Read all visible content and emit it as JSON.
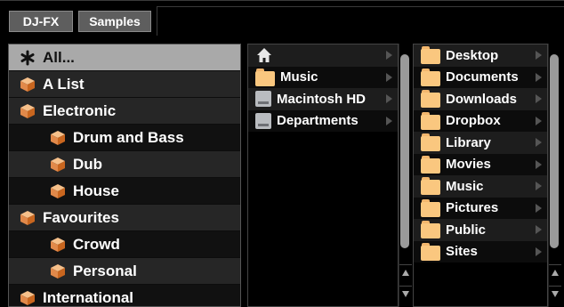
{
  "tabs": [
    {
      "label": "DJ-FX"
    },
    {
      "label": "Samples"
    }
  ],
  "tree": {
    "items": [
      {
        "label": "All...",
        "icon": "asterisk-icon",
        "indent": 0,
        "selected": true
      },
      {
        "label": "A List",
        "icon": "crate-icon",
        "indent": 0
      },
      {
        "label": "Electronic",
        "icon": "crate-icon",
        "indent": 0
      },
      {
        "label": "Drum and Bass",
        "icon": "crate-icon",
        "indent": 1
      },
      {
        "label": "Dub",
        "icon": "crate-icon",
        "indent": 1
      },
      {
        "label": "House",
        "icon": "crate-icon",
        "indent": 1
      },
      {
        "label": "Favourites",
        "icon": "crate-icon",
        "indent": 0
      },
      {
        "label": "Crowd",
        "icon": "crate-icon",
        "indent": 1
      },
      {
        "label": "Personal",
        "icon": "crate-icon",
        "indent": 1
      },
      {
        "label": "International",
        "icon": "crate-icon",
        "indent": 0
      }
    ]
  },
  "locations": {
    "items": [
      {
        "label": "",
        "icon": "home-icon"
      },
      {
        "label": "Music",
        "icon": "folder-icon"
      },
      {
        "label": "Macintosh HD",
        "icon": "drive-icon"
      },
      {
        "label": "Departments",
        "icon": "drive-icon"
      }
    ]
  },
  "folders": {
    "items": [
      {
        "label": "Desktop",
        "icon": "folder-icon"
      },
      {
        "label": "Documents",
        "icon": "folder-icon"
      },
      {
        "label": "Downloads",
        "icon": "folder-icon"
      },
      {
        "label": "Dropbox",
        "icon": "folder-icon"
      },
      {
        "label": "Library",
        "icon": "folder-icon"
      },
      {
        "label": "Movies",
        "icon": "folder-icon"
      },
      {
        "label": "Music",
        "icon": "folder-icon"
      },
      {
        "label": "Pictures",
        "icon": "folder-icon"
      },
      {
        "label": "Public",
        "icon": "folder-icon"
      },
      {
        "label": "Sites",
        "icon": "folder-icon"
      }
    ]
  },
  "colors": {
    "crate_top": "#f6c08a",
    "crate_side": "#d9762a",
    "folder": "#fac77f",
    "selected_row": "#a9a9a9"
  }
}
